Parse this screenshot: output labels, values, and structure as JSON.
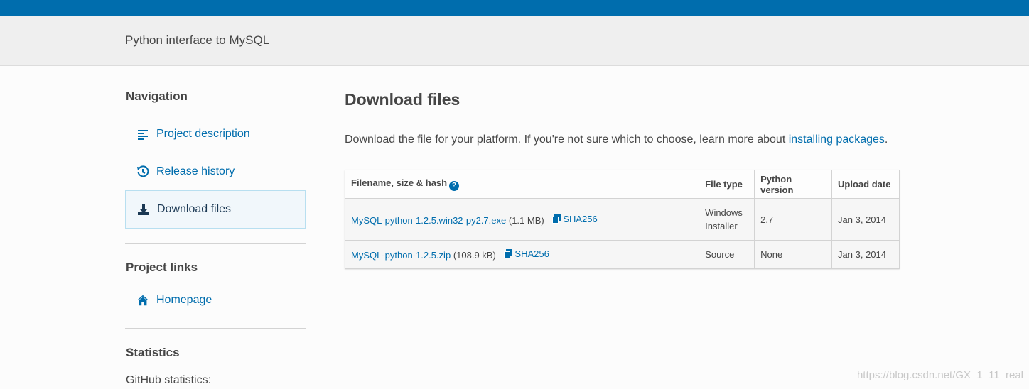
{
  "banner": {
    "summary": "Python interface to MySQL"
  },
  "sidebar": {
    "navigation_heading": "Navigation",
    "nav_items": [
      {
        "label": "Project description",
        "icon": "align-left-icon"
      },
      {
        "label": "Release history",
        "icon": "history-icon"
      },
      {
        "label": "Download files",
        "icon": "download-icon",
        "active": true
      }
    ],
    "project_links_heading": "Project links",
    "links": [
      {
        "label": "Homepage",
        "icon": "home-icon"
      }
    ],
    "statistics_heading": "Statistics",
    "github_stats": "GitHub statistics:"
  },
  "main": {
    "title": "Download files",
    "intro_text": "Download the file for your platform. If you're not sure which to choose, learn more about ",
    "intro_link": "installing packages",
    "intro_end": ".",
    "table": {
      "headers": [
        "Filename, size & hash",
        "File type",
        "Python version",
        "Upload date"
      ],
      "help_icon": "?",
      "rows": [
        {
          "filename": "MySQL-python-1.2.5.win32-py2.7.exe",
          "size": "(1.1 MB)",
          "hash": "SHA256",
          "file_type": "Windows Installer",
          "python_version": "2.7",
          "upload_date": "Jan 3, 2014"
        },
        {
          "filename": "MySQL-python-1.2.5.zip",
          "size": "(108.9 kB)",
          "hash": "SHA256",
          "file_type": "Source",
          "python_version": "None",
          "upload_date": "Jan 3, 2014"
        }
      ]
    }
  },
  "watermark": "https://blog.csdn.net/GX_1_11_real",
  "colors": {
    "brand": "#006dad",
    "banner_bg": "#efefef",
    "active_bg": "#f1f7fb"
  }
}
